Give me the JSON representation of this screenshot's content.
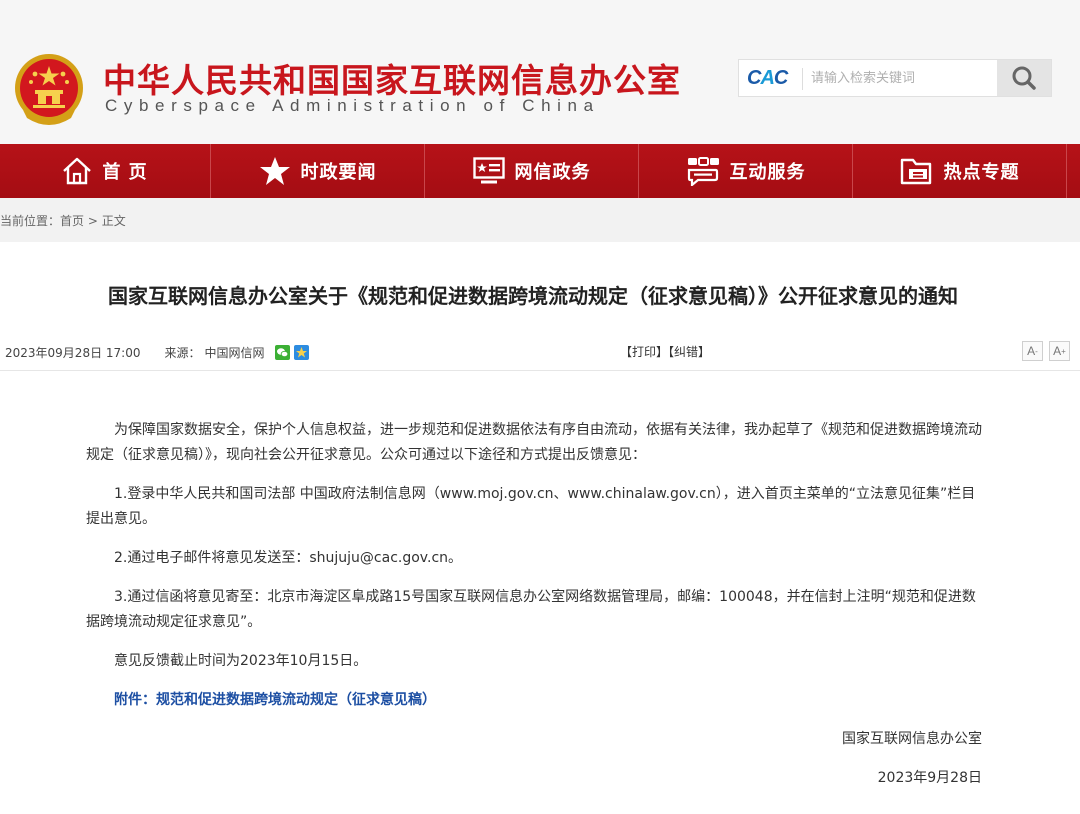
{
  "header": {
    "title_cn": "中华人民共和国国家互联网信息办公室",
    "title_en": "Cyberspace Administration of China",
    "cac_logo": "CAC",
    "search_placeholder": "请输入检索关键词",
    "icons": {
      "emblem": "national-emblem-icon",
      "search": "search-icon"
    }
  },
  "nav": {
    "items": [
      {
        "label": "首 页",
        "icon": "home-icon"
      },
      {
        "label": "时政要闻",
        "icon": "star-icon"
      },
      {
        "label": "网信政务",
        "icon": "monitor-icon"
      },
      {
        "label": "互动服务",
        "icon": "chat-icon"
      },
      {
        "label": "热点专题",
        "icon": "folder-icon"
      }
    ]
  },
  "breadcrumb": {
    "prefix": "当前位置：",
    "home": "首页",
    "sep": " > ",
    "current": "正文"
  },
  "article": {
    "title": "国家互联网信息办公室关于《规范和促进数据跨境流动规定（征求意见稿）》公开征求意见的通知",
    "date": "2023年09月28日 17:00",
    "source_label": "来源：",
    "source": "中国网信网",
    "print": "【打印】",
    "correction": "【纠错】",
    "font_smaller": "A",
    "font_larger": "A",
    "paragraphs": [
      "为保障国家数据安全，保护个人信息权益，进一步规范和促进数据依法有序自由流动，依据有关法律，我办起草了《规范和促进数据跨境流动规定（征求意见稿）》，现向社会公开征求意见。公众可通过以下途径和方式提出反馈意见：",
      "1.登录中华人民共和国司法部 中国政府法制信息网（www.moj.gov.cn、www.chinalaw.gov.cn），进入首页主菜单的“立法意见征集”栏目提出意见。",
      "2.通过电子邮件将意见发送至：shujuju@cac.gov.cn。",
      "3.通过信函将意见寄至：北京市海淀区阜成路15号国家互联网信息办公室网络数据管理局，邮编：100048，并在信封上注明“规范和促进数据跨境流动规定征求意见”。",
      "意见反馈截止时间为2023年10月15日。"
    ],
    "attachment": "附件：规范和促进数据跨境流动规定（征求意见稿）",
    "signature": "国家互联网信息办公室",
    "sign_date": "2023年9月28日"
  },
  "colors": {
    "brand_red": "#c8161d",
    "nav_red": "#b61218",
    "link_blue": "#1d4fa3"
  }
}
